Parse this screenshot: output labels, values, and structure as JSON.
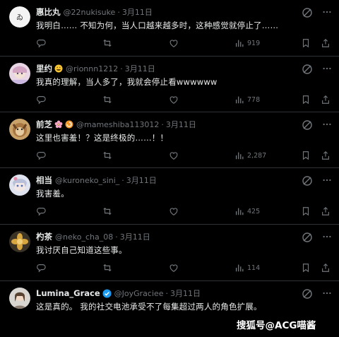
{
  "tweets": [
    {
      "name": "惠比丸",
      "handle": "@22nukisuke",
      "separator": "·",
      "time": "3月11日",
      "text": "我明白…… 不知为何，当人口越来越多时，这种感觉就停止了……",
      "views": "919",
      "name_emoji": ""
    },
    {
      "name": "里约",
      "handle": "@rionnn1212",
      "separator": "·",
      "time": "3月11日",
      "text": "我真的理解，当人多了，我就会停止看wwwwww",
      "views": "778",
      "name_emoji": "grinning-face-emoji"
    },
    {
      "name": "前芝",
      "handle": "@mameshiba113012",
      "separator": "·",
      "time": "3月11日",
      "text": "这里也害羞！？这是终极的……！！",
      "views": "2,287",
      "name_emoji": "cherry-blossom-emoji"
    },
    {
      "name": "相当",
      "handle": "@kuroneko_sini_",
      "separator": "·",
      "time": "3月11日",
      "text": "我害羞。",
      "views": "425",
      "name_emoji": ""
    },
    {
      "name": "杓茶",
      "handle": "@neko_cha_08",
      "separator": "·",
      "time": "3月11日",
      "text": "我讨厌自己知道这些事。",
      "views": "114",
      "name_emoji": ""
    },
    {
      "name": "Lumina_Grace",
      "handle": "@JoyGraciee",
      "separator": "·",
      "time": "3月11日",
      "text": "这是真的。 我的社交电池承受不了每集超过两人的角色扩展。",
      "views": "",
      "name_emoji": "verified-badge"
    }
  ],
  "watermark": "搜狐号@ACG喵酱",
  "colors": {
    "background": "#000000",
    "text": "#e7e9ea",
    "muted": "#71767b",
    "divider": "#2f3336",
    "verified": "#1d9bf0"
  }
}
